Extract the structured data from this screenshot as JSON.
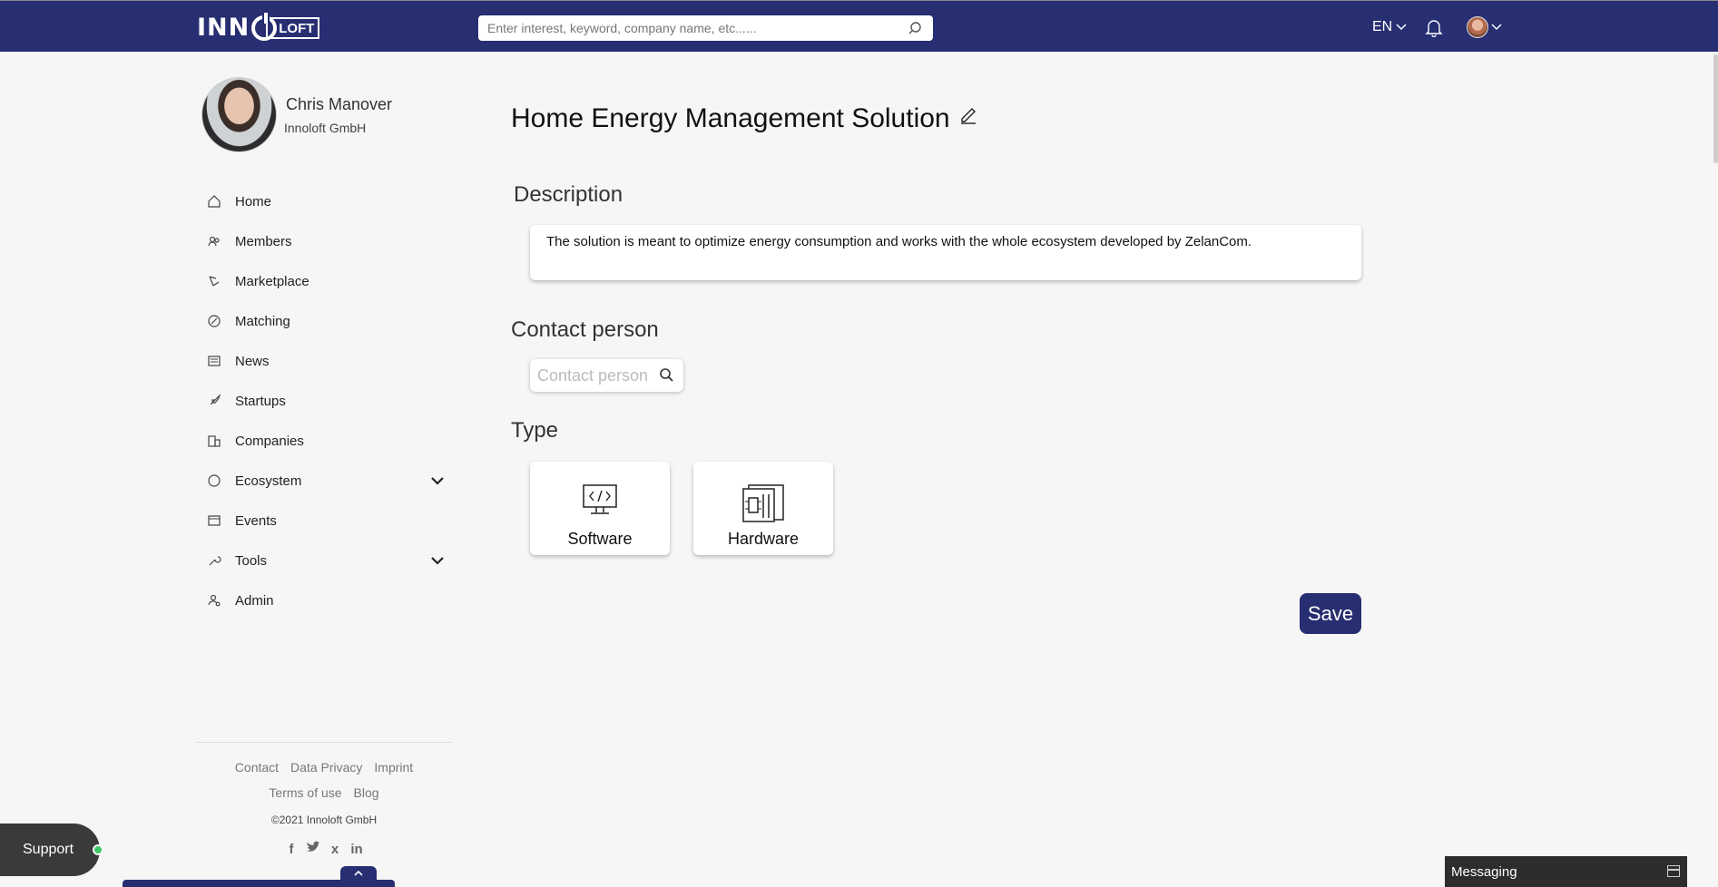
{
  "header": {
    "logo_left": "INN",
    "logo_right": "LOFT",
    "search_placeholder": "Enter interest, keyword, company name, etc......",
    "language": "EN"
  },
  "profile": {
    "name": "Chris Manover",
    "company": "Innoloft GmbH"
  },
  "sidebar": {
    "items": [
      {
        "label": "Home",
        "icon": "home-icon"
      },
      {
        "label": "Members",
        "icon": "members-icon"
      },
      {
        "label": "Marketplace",
        "icon": "marketplace-icon"
      },
      {
        "label": "Matching",
        "icon": "matching-icon"
      },
      {
        "label": "News",
        "icon": "news-icon"
      },
      {
        "label": "Startups",
        "icon": "rocket-icon"
      },
      {
        "label": "Companies",
        "icon": "building-icon"
      },
      {
        "label": "Ecosystem",
        "icon": "circle-icon"
      },
      {
        "label": "Events",
        "icon": "calendar-icon"
      },
      {
        "label": "Tools",
        "icon": "tools-icon"
      },
      {
        "label": "Admin",
        "icon": "admin-icon"
      }
    ]
  },
  "footer": {
    "links_row1": [
      "Contact",
      "Data Privacy",
      "Imprint"
    ],
    "links_row2": [
      "Terms of use",
      "Blog"
    ],
    "copyright": "©2021 Innoloft GmbH",
    "socials": [
      "f",
      "t",
      "x",
      "in"
    ]
  },
  "main": {
    "title": "Home Energy Management Solution",
    "description_heading": "Description",
    "description_text": "The solution is meant to optimize energy consumption and works with the whole ecosystem developed by ZelanCom.",
    "contact_heading": "Contact person",
    "contact_placeholder": "Contact person",
    "type_heading": "Type",
    "types": [
      "Software",
      "Hardware"
    ],
    "save_label": "Save"
  },
  "support_label": "Support",
  "messaging_label": "Messaging",
  "colors": {
    "brand": "#272e71",
    "background": "#f6f6f6",
    "online": "#3cc668"
  }
}
